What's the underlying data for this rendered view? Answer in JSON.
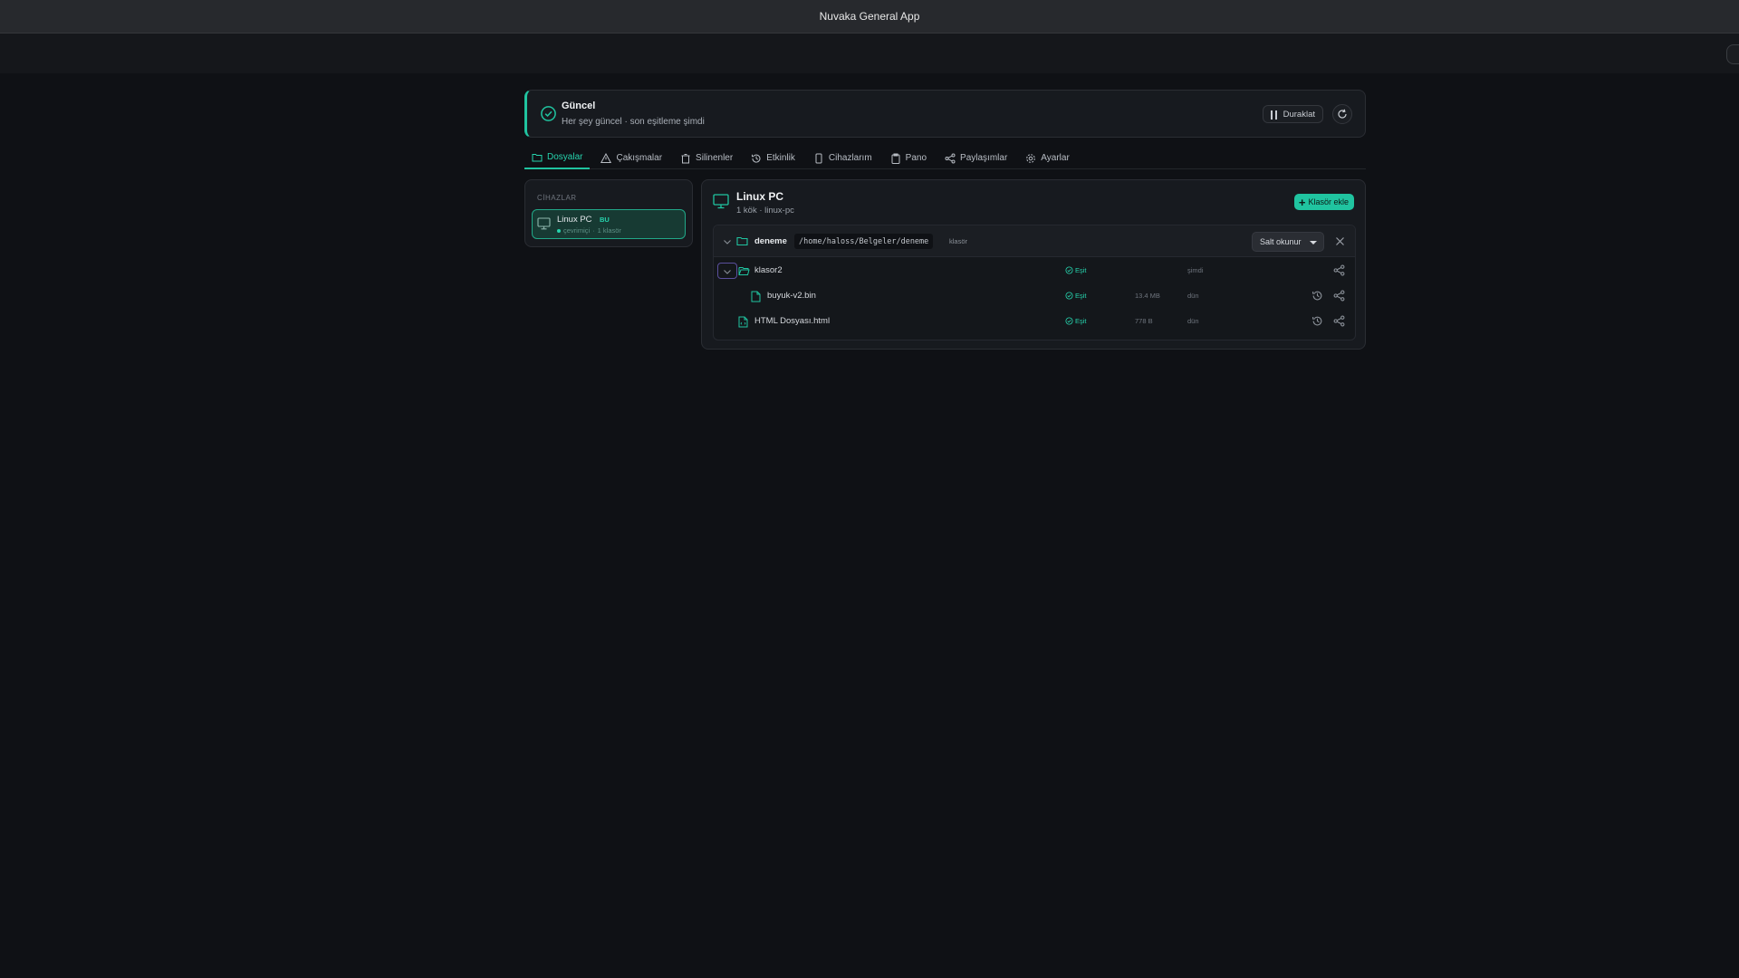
{
  "window": {
    "title": "Nuvaka General App"
  },
  "status": {
    "title": "Güncel",
    "subtitle": "Her şey güncel · son eşitleme şimdi",
    "pause_label": "Duraklat"
  },
  "tabs": [
    {
      "label": "Dosyalar",
      "icon": "folder-icon",
      "active": true
    },
    {
      "label": "Çakışmalar",
      "icon": "warning-icon"
    },
    {
      "label": "Silinenler",
      "icon": "trash-icon"
    },
    {
      "label": "Etkinlik",
      "icon": "history-icon"
    },
    {
      "label": "Cihazlarım",
      "icon": "phone-icon"
    },
    {
      "label": "Pano",
      "icon": "clipboard-icon"
    },
    {
      "label": "Paylaşımlar",
      "icon": "share-icon"
    },
    {
      "label": "Ayarlar",
      "icon": "gear-icon"
    }
  ],
  "devices": {
    "heading": "CİHAZLAR",
    "items": [
      {
        "name": "Linux PC",
        "badge": "BU",
        "status": "çevrimiçi",
        "meta": "1 klasör"
      }
    ]
  },
  "content": {
    "title": "Linux PC",
    "subtitle": "1 kök · linux-pc",
    "add_label": "Klasör ekle",
    "root": {
      "name": "deneme",
      "path": "/home/haloss/Belgeler/deneme",
      "type": "klasör",
      "mode": "Salt okunur"
    },
    "rows": [
      {
        "name": "klasor2",
        "status": "Eşit",
        "size": "",
        "time": "şimdi"
      },
      {
        "name": "buyuk-v2.bin",
        "status": "Eşit",
        "size": "13.4 MB",
        "time": "dün"
      },
      {
        "name": "HTML Dosyası.html",
        "status": "Eşit",
        "size": "778 B",
        "time": "dün"
      }
    ]
  },
  "colors": {
    "accent": "#20c4a0",
    "background": "#0f1115",
    "panel": "#171a1f"
  }
}
